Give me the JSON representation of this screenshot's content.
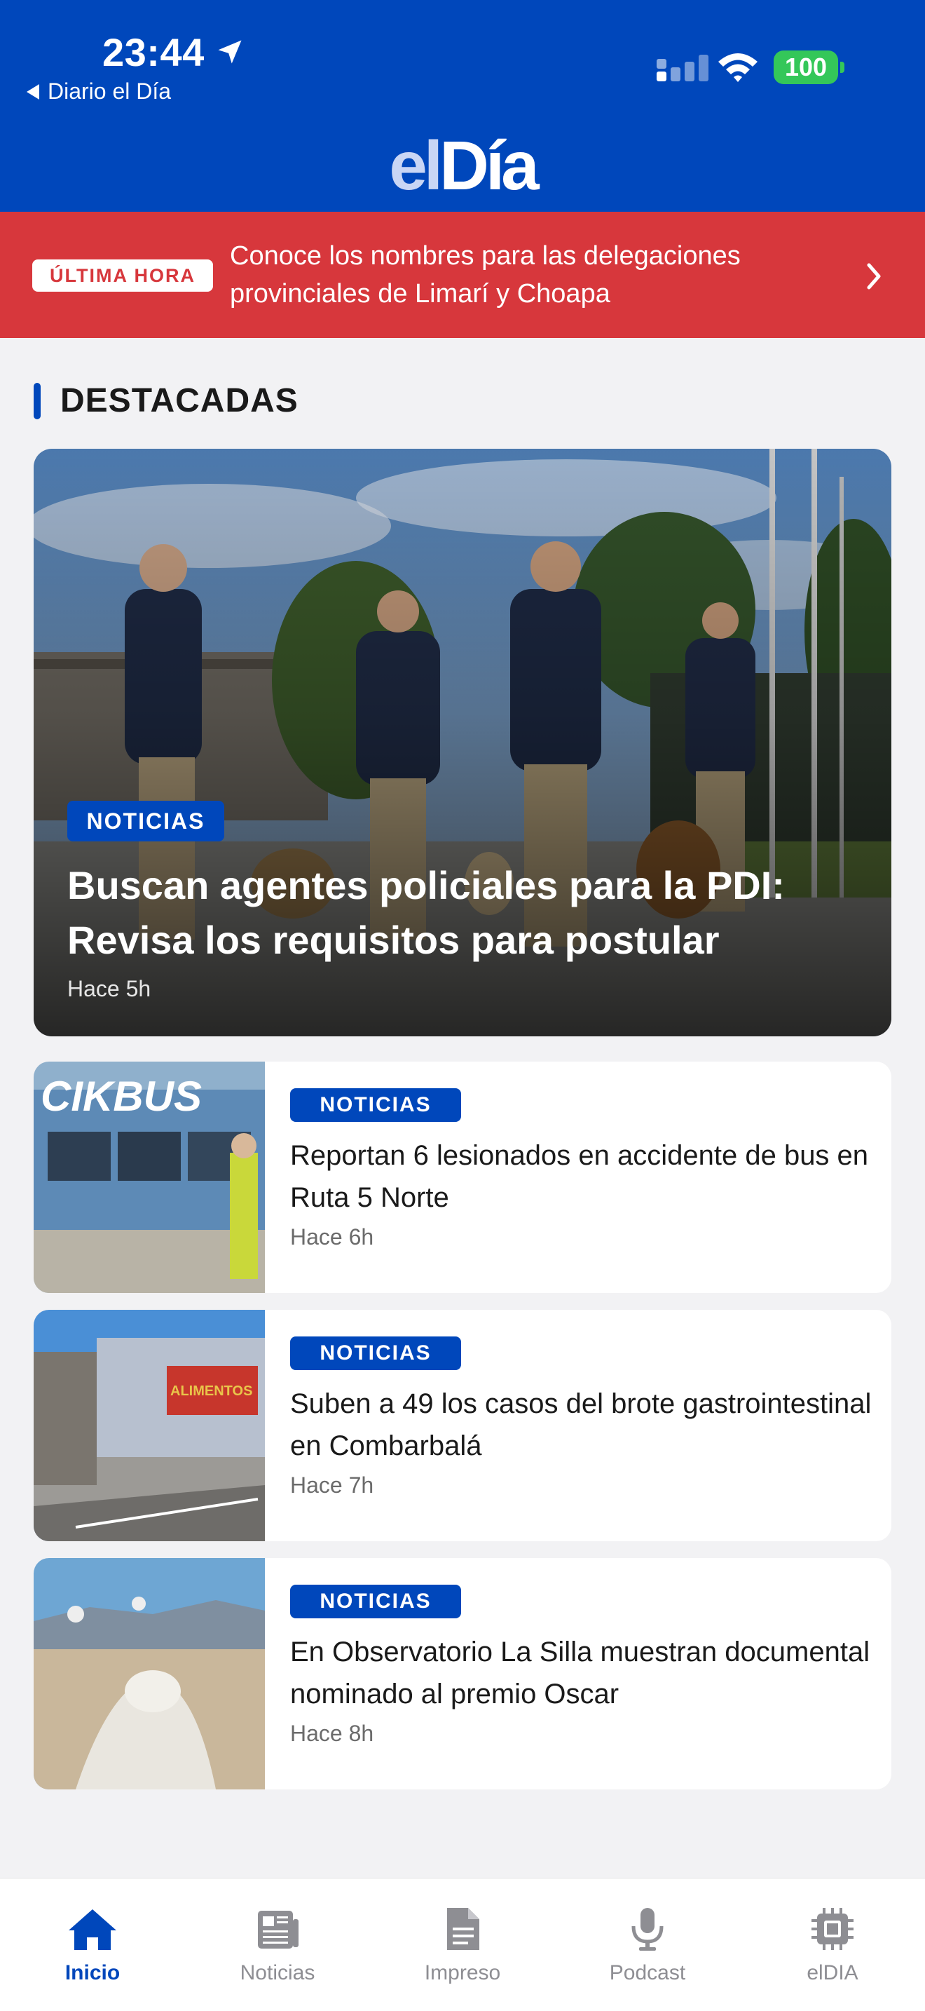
{
  "status_bar": {
    "time": "23:44",
    "back_label": "Diario el Día",
    "battery": "100"
  },
  "app": {
    "logo_part1": "el",
    "logo_part2": "Día"
  },
  "breaking": {
    "badge": "ÚLTIMA HORA",
    "text": "Conoce los nombres para las delegaciones provinciales de Limarí y Choapa"
  },
  "section": {
    "title": "DESTACADAS"
  },
  "featured": {
    "category": "NOTICIAS",
    "title": "Buscan agentes policiales para la PDI: Revisa los requisitos para postular",
    "time": "Hace 5h"
  },
  "articles": [
    {
      "category": "NOTICIAS",
      "title": "Reportan 6 lesionados en accidente de bus en Ruta 5 Norte",
      "time": "Hace 6h"
    },
    {
      "category": "NOTICIAS",
      "title": "Suben a 49 los casos del brote gastrointestinal en Combarbalá",
      "time": "Hace 7h"
    },
    {
      "category": "NOTICIAS",
      "title": "En Observatorio La Silla muestran documental nominado al premio Oscar",
      "time": "Hace 8h"
    }
  ],
  "thumb_texts": {
    "bus_sign": "CIKBUS",
    "building_sign": "ALIMENTOS"
  },
  "tabs": [
    {
      "label": "Inicio",
      "icon": "home-icon",
      "active": true
    },
    {
      "label": "Noticias",
      "icon": "newspaper-icon",
      "active": false
    },
    {
      "label": "Impreso",
      "icon": "document-icon",
      "active": false
    },
    {
      "label": "Podcast",
      "icon": "microphone-icon",
      "active": false
    },
    {
      "label": "elDIA",
      "icon": "chip-icon",
      "active": false
    }
  ],
  "colors": {
    "brand_blue": "#0047bb",
    "breaking_red": "#d7373c",
    "battery_green": "#34c759"
  }
}
